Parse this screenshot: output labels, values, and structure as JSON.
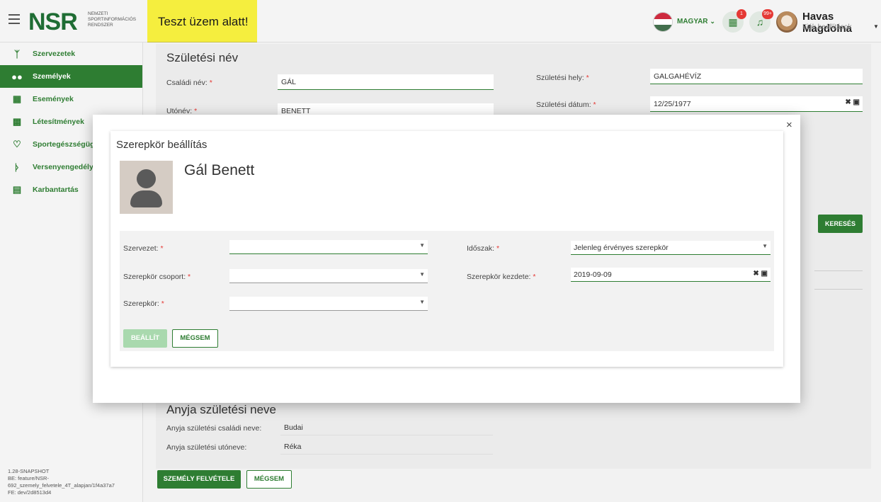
{
  "header": {
    "logo_text": "NSR",
    "logo_sub_line1": "NEMZETI",
    "logo_sub_line2": "SPORTINFORMÁCIÓS",
    "logo_sub_line3": "RENDSZER",
    "test_banner": "Teszt üzem alatt!",
    "language": "MAGYAR",
    "badge_tasks": "1",
    "badge_notifications": "99+",
    "user_name": "Havas Magdolna",
    "user_sub": "Fiók beállítások"
  },
  "sidebar": {
    "items": [
      {
        "label": "Szervezetek",
        "icon": "org-tree-icon"
      },
      {
        "label": "Személyek",
        "icon": "people-icon"
      },
      {
        "label": "Események",
        "icon": "calendar-icon"
      },
      {
        "label": "Létesítmények",
        "icon": "building-icon"
      },
      {
        "label": "Sportegészségügy",
        "icon": "heart-icon"
      },
      {
        "label": "Versenyengedélyek",
        "icon": "runner-icon"
      },
      {
        "label": "Karbantartás",
        "icon": "clipboard-icon"
      }
    ],
    "version_line1": "1.28-SNAPSHOT",
    "version_line2": "BE: feature/NSR-",
    "version_line3": "692_szemely_felvetele_4T_alapjan/1f4a37a7",
    "version_line4": "FE: dev/2d8513d4"
  },
  "main": {
    "section_birth_name": "Születési név",
    "family_name_label": "Családi név:",
    "family_name_value": "GÁL",
    "first_name_label": "Utónév:",
    "first_name_value": "BENETT",
    "birth_place_label": "Születési hely:",
    "birth_place_value": "GALGAHÉVÍZ",
    "birth_date_label": "Születési dátum:",
    "birth_date_value": "12/25/1977",
    "search_button": "KERESÉS",
    "section_mother": "Anyja születési neve",
    "mother_family_label": "Anyja születési családi neve:",
    "mother_family_value": "Budai",
    "mother_first_label": "Anyja születési utóneve:",
    "mother_first_value": "Réka",
    "add_person_button": "SZEMÉLY FELVÉTELE",
    "cancel_button": "MÉGSEM"
  },
  "modal": {
    "close": "×",
    "title": "Szerepkör beállítás",
    "person_name": "Gál Benett",
    "org_label": "Szervezet:",
    "org_value": "",
    "period_label": "Időszak:",
    "period_value": "Jelenleg érvényes szerepkör",
    "role_group_label": "Szerepkör csoport:",
    "role_group_value": "",
    "role_start_label": "Szerepkör kezdete:",
    "role_start_value": "2019-09-09",
    "role_label": "Szerepkör:",
    "role_value": "",
    "set_button": "BEÁLLÍT",
    "cancel_button": "MÉGSEM"
  },
  "colors": {
    "brand_green": "#2e7d32",
    "banner_yellow": "#f5ee3e",
    "required_red": "#e53935"
  }
}
